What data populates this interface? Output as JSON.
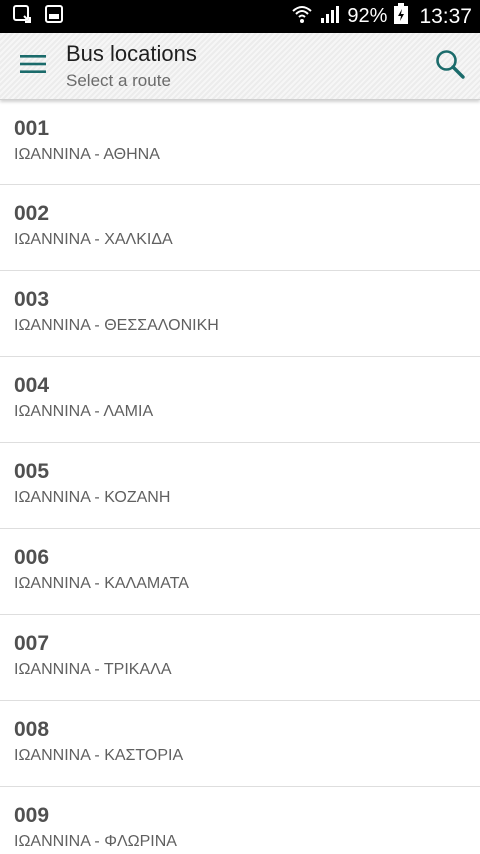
{
  "status_bar": {
    "battery": "92%",
    "time": "13:37"
  },
  "app_bar": {
    "title": "Bus locations",
    "subtitle": "Select a route"
  },
  "routes": [
    {
      "code": "001",
      "name": "ΙΩΑΝΝΙΝΑ - ΑΘΗΝΑ"
    },
    {
      "code": "002",
      "name": "ΙΩΑΝΝΙΝΑ - ΧΑΛΚΙΔΑ"
    },
    {
      "code": "003",
      "name": "ΙΩΑΝΝΙΝΑ - ΘΕΣΣΑΛΟΝΙΚΗ"
    },
    {
      "code": "004",
      "name": "ΙΩΑΝΝΙΝΑ - ΛΑΜΙΑ"
    },
    {
      "code": "005",
      "name": "ΙΩΑΝΝΙΝΑ - ΚΟΖΑΝΗ"
    },
    {
      "code": "006",
      "name": "ΙΩΑΝΝΙΝΑ - ΚΑΛΑΜΑΤΑ"
    },
    {
      "code": "007",
      "name": "ΙΩΑΝΝΙΝΑ - ΤΡΙΚΑΛΑ"
    },
    {
      "code": "008",
      "name": "ΙΩΑΝΝΙΝΑ - ΚΑΣΤΟΡΙΑ"
    },
    {
      "code": "009",
      "name": "ΙΩΑΝΝΙΝΑ - ΦΛΩΡΙΝΑ"
    }
  ],
  "colors": {
    "accent": "#1b6b6b",
    "status_bar_bg": "#000000",
    "app_bar_bg": "#f0f0f0"
  },
  "icons": {
    "menu": "hamburger-menu-icon",
    "search": "search-icon"
  }
}
